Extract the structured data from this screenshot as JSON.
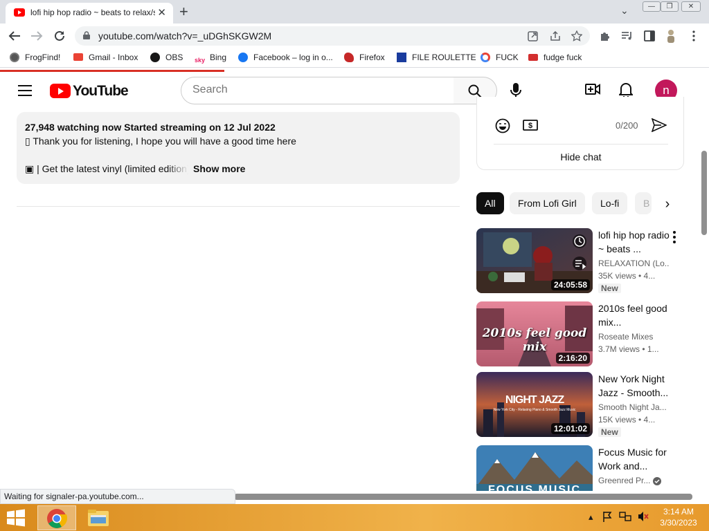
{
  "browser": {
    "tab_title": "lofi hip hop radio ~ beats to relax/study to",
    "url": "youtube.com/watch?v=_uDGhSKGW2M",
    "window_buttons": {
      "minimize": "—",
      "restore": "❐",
      "close": "✕"
    },
    "new_tab_label": "+",
    "tab_close_label": "✕",
    "tab_search_label": "⌄",
    "bookmarks": [
      {
        "label": "FrogFind!",
        "icon": "globe-icon",
        "color": "#555555"
      },
      {
        "label": "Gmail - Inbox",
        "icon": "gmail-icon",
        "color": "#ea4335"
      },
      {
        "label": "OBS",
        "icon": "github-icon",
        "color": "#181717"
      },
      {
        "label": "Bing",
        "icon": "bing-icon",
        "color": "#0a66c2"
      },
      {
        "label": "Facebook – log in o...",
        "icon": "facebook-icon",
        "color": "#1877f2"
      },
      {
        "label": "Firefox",
        "icon": "firefox-icon",
        "color": "#d32f2f"
      },
      {
        "label": "FILE ROULETTE",
        "icon": "file-roulette-icon",
        "color": "#1a3c9e"
      },
      {
        "label": "FUCK",
        "icon": "google-icon",
        "color": "#4285f4"
      },
      {
        "label": "fudge fuck",
        "icon": "mail-icon",
        "color": "#d32f2f"
      }
    ],
    "status_text": "Waiting for signaler-pa.youtube.com..."
  },
  "youtube": {
    "logo_text": "YouTube",
    "search_placeholder": "Search",
    "avatar_letter": "n",
    "description": {
      "meta": "27,948 watching now  Started streaming on 12 Jul 2022",
      "line1": "▯ Thank you for listening, I hope you will have a good time here",
      "line2": "▣ | Get the latest vinyl (limited edition)",
      "show_more": "Show more"
    },
    "chat": {
      "char_count": "0/200",
      "hide_chat": "Hide chat"
    },
    "chips": [
      "All",
      "From Lofi Girl",
      "Lo-fi",
      "B"
    ],
    "videos": [
      {
        "title": "lofi hip hop radio ~ beats ...",
        "channel": "RELAXATION (Lo...",
        "views": "35K views  • 4...",
        "badge": "New",
        "duration": "24:05:58"
      },
      {
        "title": "2010s feel good mix...",
        "channel": "Roseate Mixes",
        "views": "3.7M views  • 1...",
        "badge": "",
        "duration": "2:16:20",
        "thumb_text": "2010s feel good mix"
      },
      {
        "title": "New York Night Jazz - Smooth...",
        "channel": "Smooth Night Ja...",
        "views": "15K views  • 4...",
        "badge": "New",
        "duration": "12:01:02",
        "thumb_text": "NIGHT JAZZ",
        "thumb_subtext": "New York City - Relaxing Piano & Smooth Jazz Music"
      },
      {
        "title": "Focus Music for Work and...",
        "channel": "Greenred Pr...",
        "views": "",
        "badge": "",
        "duration": "",
        "thumb_text": "FOCUS MUSIC"
      }
    ]
  },
  "taskbar": {
    "time": "3:14 AM",
    "date": "3/30/2023"
  },
  "colors": {
    "youtube_red": "#ff0000",
    "avatar_bg": "#c2185b",
    "taskbar": "#e79a2c",
    "loading_bar": "#d93025"
  }
}
